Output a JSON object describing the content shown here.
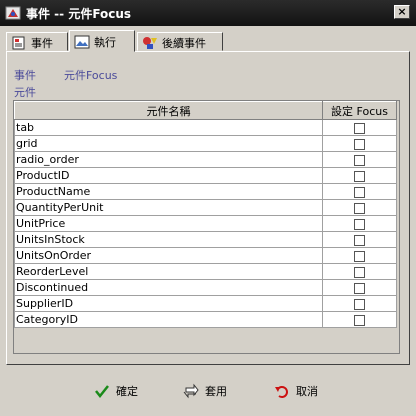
{
  "window": {
    "title": "事件 -- 元件Focus"
  },
  "tabs": [
    {
      "label": "事件",
      "icon": "document-icon",
      "active": false
    },
    {
      "label": "執行",
      "icon": "image-icon",
      "active": true
    },
    {
      "label": "後續事件",
      "icon": "shapes-icon",
      "active": false
    }
  ],
  "info": {
    "event_label": "事件",
    "event_value": "元件Focus",
    "component_label": "元件"
  },
  "table": {
    "columns": [
      "元件名稱",
      "設定 Focus"
    ],
    "rows": [
      {
        "name": "tab",
        "checked": false
      },
      {
        "name": "grid",
        "checked": false
      },
      {
        "name": "radio_order",
        "checked": false
      },
      {
        "name": "ProductID",
        "checked": false
      },
      {
        "name": "ProductName",
        "checked": false
      },
      {
        "name": "QuantityPerUnit",
        "checked": false
      },
      {
        "name": "UnitPrice",
        "checked": false
      },
      {
        "name": "UnitsInStock",
        "checked": false
      },
      {
        "name": "UnitsOnOrder",
        "checked": false
      },
      {
        "name": "ReorderLevel",
        "checked": false
      },
      {
        "name": "Discontinued",
        "checked": false
      },
      {
        "name": "SupplierID",
        "checked": false
      },
      {
        "name": "CategoryID",
        "checked": false
      }
    ]
  },
  "buttons": {
    "ok": "確定",
    "apply": "套用",
    "cancel": "取消"
  },
  "colors": {
    "info_text": "#4a4a9a",
    "ok_icon": "#1a8a1a",
    "cancel_icon": "#cc1111"
  }
}
